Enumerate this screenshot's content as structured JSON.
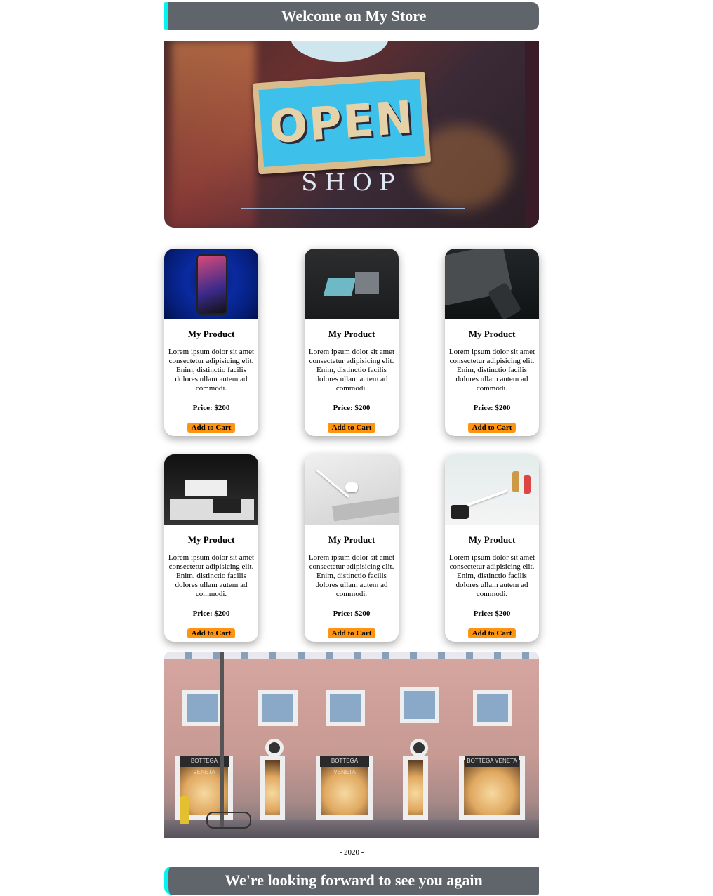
{
  "header": {
    "title": "Welcome on My Store"
  },
  "hero": {
    "sign_text": "OPEN",
    "shop_text": "SHOP"
  },
  "products": [
    {
      "name": "My Product",
      "description": "Lorem ipsum dolor sit amet consectetur adipisicing elit. Enim, distinctio facilis dolores ullam autem ad commodi.",
      "price": "Price: $200",
      "button": "Add to Cart"
    },
    {
      "name": "My Product",
      "description": "Lorem ipsum dolor sit amet consectetur adipisicing elit. Enim, distinctio facilis dolores ullam autem ad commodi.",
      "price": "Price: $200",
      "button": "Add to Cart"
    },
    {
      "name": "My Product",
      "description": "Lorem ipsum dolor sit amet consectetur adipisicing elit. Enim, distinctio facilis dolores ullam autem ad commodi.",
      "price": "Price: $200",
      "button": "Add to Cart"
    },
    {
      "name": "My Product",
      "description": "Lorem ipsum dolor sit amet consectetur adipisicing elit. Enim, distinctio facilis dolores ullam autem ad commodi.",
      "price": "Price: $200",
      "button": "Add to Cart"
    },
    {
      "name": "My Product",
      "description": "Lorem ipsum dolor sit amet consectetur adipisicing elit. Enim, distinctio facilis dolores ullam autem ad commodi.",
      "price": "Price: $200",
      "button": "Add to Cart"
    },
    {
      "name": "My Product",
      "description": "Lorem ipsum dolor sit amet consectetur adipisicing elit. Enim, distinctio facilis dolores ullam autem ad commodi.",
      "price": "Price: $200",
      "button": "Add to Cart"
    }
  ],
  "storefront": {
    "shop_sign": "BOTTEGA VENETA"
  },
  "footer": {
    "year": "- 2020 -",
    "farewell": "We're looking forward to see you again"
  },
  "colors": {
    "banner_bg": "#5f656a",
    "banner_accent": "#00f5f0",
    "button_bg": "#ff9410"
  }
}
